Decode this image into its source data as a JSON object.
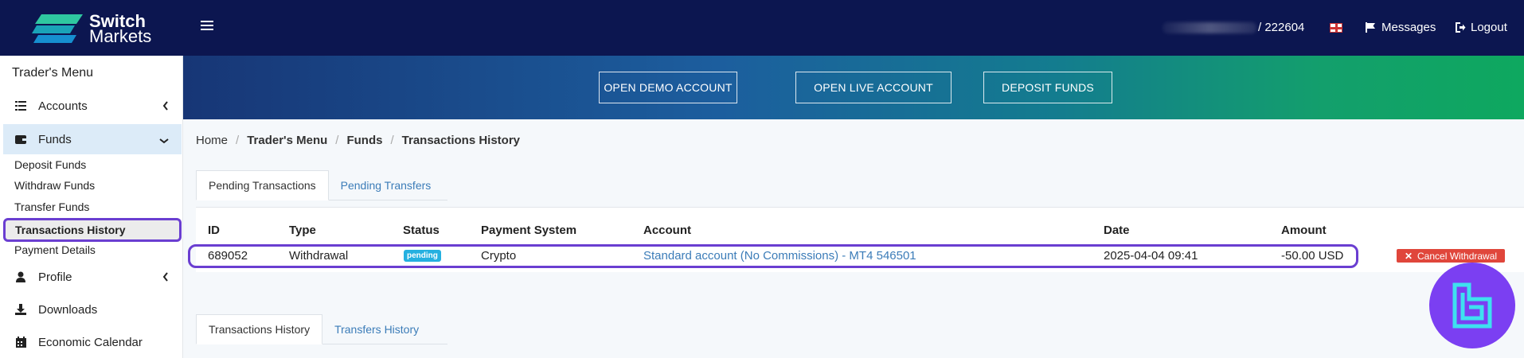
{
  "header": {
    "logo_line1": "Switch",
    "logo_line2": "Markets",
    "account_number": "/ 222604",
    "messages_label": "Messages",
    "logout_label": "Logout"
  },
  "sidebar": {
    "title": "Trader's Menu",
    "items": [
      {
        "label": "Accounts",
        "icon": "list-icon"
      },
      {
        "label": "Funds",
        "icon": "wallet-icon"
      },
      {
        "label": "Profile",
        "icon": "user-icon"
      },
      {
        "label": "Downloads",
        "icon": "download-icon"
      },
      {
        "label": "Economic Calendar",
        "icon": "calendar-icon"
      }
    ],
    "funds_sub": [
      "Deposit Funds",
      "Withdraw Funds",
      "Transfer Funds",
      "Transactions History",
      "Payment Details"
    ]
  },
  "banner": {
    "buttons": [
      "OPEN DEMO ACCOUNT",
      "OPEN LIVE ACCOUNT",
      "DEPOSIT FUNDS"
    ]
  },
  "breadcrumb": [
    "Home",
    "Trader's Menu",
    "Funds",
    "Transactions History"
  ],
  "pending_tabs": [
    "Pending Transactions",
    "Pending Transfers"
  ],
  "table": {
    "headers": [
      "ID",
      "Type",
      "Status",
      "Payment System",
      "Account",
      "Date",
      "Amount"
    ],
    "rows": [
      {
        "id": "689052",
        "type": "Withdrawal",
        "status": "pending",
        "payment_system": "Crypto",
        "account": "Standard account (No Commissions) - MT4 546501",
        "date": "2025-04-04 09:41",
        "amount": "-50.00 USD",
        "action": "Cancel Withdrawal"
      }
    ]
  },
  "history_tabs": [
    "Transactions History",
    "Transfers History"
  ],
  "colors": {
    "topbar": "#0c1650",
    "accent": "#3b7cb8",
    "highlight": "#6a3ed1",
    "badge": "#25b0e0",
    "cancel": "#e0463b"
  }
}
